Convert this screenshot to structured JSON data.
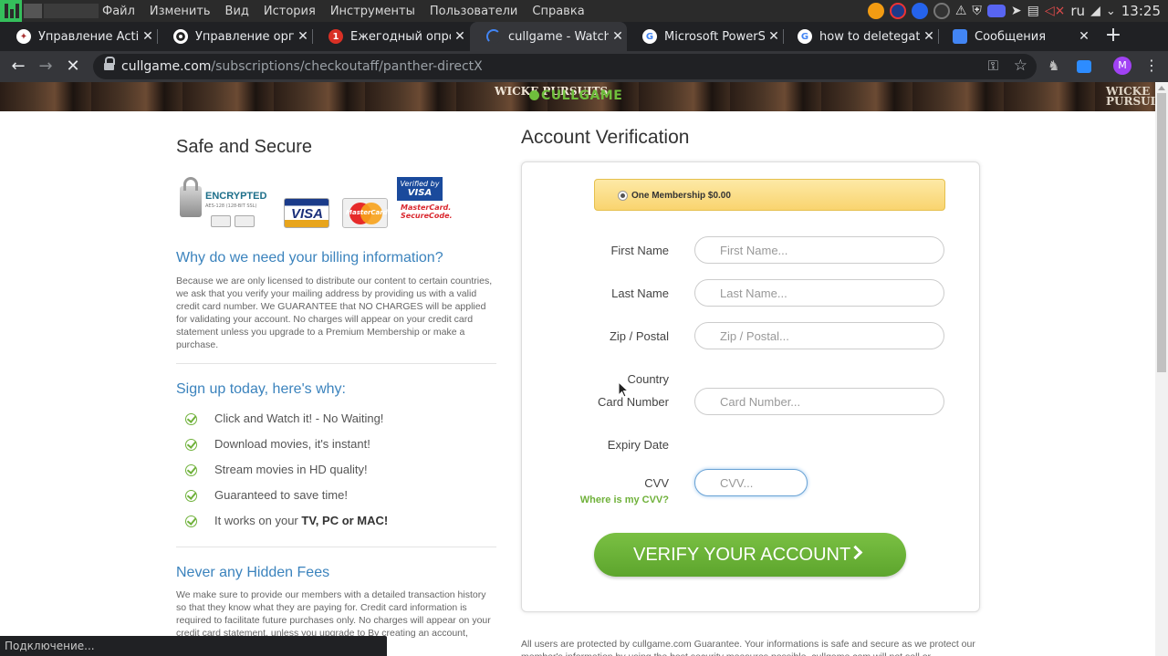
{
  "os_menu": [
    "Файл",
    "Изменить",
    "Вид",
    "История",
    "Инструменты",
    "Пользователи",
    "Справка"
  ],
  "os_tray": {
    "lang": "ru",
    "clock": "13:25"
  },
  "tabs": [
    {
      "title": "Управление Active",
      "icon": "puppet-icon"
    },
    {
      "title": "Управление орган",
      "icon": "globe-icon"
    },
    {
      "title": "Ежегодный опрос",
      "icon": "notification-badge-icon",
      "badge": "1"
    },
    {
      "title": "cullgame - Watch M",
      "icon": "loading-icon"
    },
    {
      "title": "Microsoft PowerSh",
      "icon": "google-icon"
    },
    {
      "title": "how to deletegate",
      "icon": "google-icon"
    },
    {
      "title": "Сообщения",
      "icon": "messages-icon"
    }
  ],
  "address": {
    "host": "cullgame.com",
    "path": "/subscriptions/checkoutaff/panther-directX"
  },
  "profile_initial": "M",
  "banner": {
    "brand": "CULLGAME",
    "poster_text_1": "WICKE PURSUITS",
    "poster_text_2": "WICKE PURSUITS"
  },
  "left": {
    "title": "Safe and Secure",
    "encrypted_label": "ENCRYPTED",
    "encrypted_sub": "AES-128 (128-BIT SSL)",
    "visa_label": "VISA",
    "mastercard_label": "MasterCard",
    "verified_by_visa": "Verified by",
    "verified_visa": "VISA",
    "mc_securecode_1": "MasterCard.",
    "mc_securecode_2": "SecureCode.",
    "why_heading": "Why do we need your billing information?",
    "why_text": "Because we are only licensed to distribute our content to certain countries, we ask that you verify your mailing address by providing us with a valid credit card number. We GUARANTEE that NO CHARGES will be applied for validating your account. No charges will appear on your credit card statement unless you upgrade to a Premium Membership or make a purchase.",
    "signup_heading": "Sign up today, here's why:",
    "benefits": [
      "Click and Watch it! - No Waiting!",
      "Download movies, it's instant!",
      "Stream movies in HD quality!",
      "Guaranteed to save time!"
    ],
    "benefit_last_pre": "It works on your ",
    "benefit_last_bold": "TV, PC or MAC!",
    "fees_heading": "Never any Hidden Fees",
    "fees_text": "We make sure to provide our members with a detailed transaction history so that they know what they are paying for. Credit card information is required to facilitate future purchases only. No charges will appear on your credit card statement, unless you upgrade to",
    "fees_text_tail": "By creating an account,"
  },
  "form": {
    "title": "Account Verification",
    "membership": "One Membership $0.00",
    "first_name_label": "First Name",
    "first_name_placeholder": "First Name...",
    "last_name_label": "Last Name",
    "last_name_placeholder": "Last Name...",
    "zip_label": "Zip / Postal",
    "zip_placeholder": "Zip / Postal...",
    "country_label": "Country",
    "card_label": "Card Number",
    "card_placeholder": "Card Number...",
    "expiry_label": "Expiry Date",
    "cvv_label": "CVV",
    "cvv_placeholder": "CVV...",
    "cvv_help": "Where is my CVV?",
    "submit": "VERIFY YOUR ACCOUNT"
  },
  "footer_text": "All users are protected by cullgame.com Guarantee. Your informations is safe and secure as we protect our member's information by using the best security measures possible. cullgame.com will not sell or",
  "status_text": "Подключение..."
}
